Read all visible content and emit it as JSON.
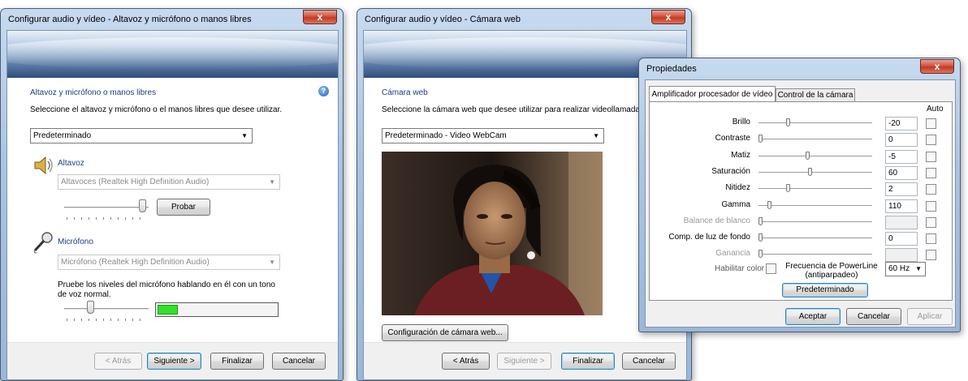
{
  "win1": {
    "title": "Configurar audio y vídeo - Altavoz y micrófono o manos libres",
    "close": "x",
    "help_glyph": "?",
    "heading": "Altavoz y micrófono o manos libres",
    "instruction": "Seleccione el altavoz y micrófono o el manos libres que desee utilizar.",
    "device_select": "Predeterminado",
    "speaker_label": "Altavoz",
    "speaker_select": "Altavoces (Realtek High Definition Audio)",
    "probar": "Probar",
    "mic_label": "Micrófono",
    "mic_select": "Micrófono (Realtek High Definition Audio)",
    "mic_hint": "Pruebe los niveles del micrófono hablando en él con un tono de voz normal.",
    "mic_level_fraction": 0.17,
    "back": "< Atrás",
    "next": "Siguiente >",
    "finish": "Finalizar",
    "cancel": "Cancelar"
  },
  "win2": {
    "title": "Configurar audio y vídeo - Cámara web",
    "close": "x",
    "heading": "Cámara web",
    "instruction": "Seleccione la cámara web que desee utilizar para realizar videollamadas",
    "cam_select": "Predeterminado - Video WebCam",
    "cam_settings": "Configuración de cámara web...",
    "back": "< Atrás",
    "next": "Siguiente >",
    "finish": "Finalizar",
    "cancel": "Cancelar"
  },
  "props": {
    "title": "Propiedades",
    "close": "x",
    "tab1": "Amplificador procesador de vídeo",
    "tab2": "Control de la cámara",
    "auto": "Auto",
    "rows": [
      {
        "label": "Brillo",
        "value": "-20",
        "enabled": true,
        "level": 0.25
      },
      {
        "label": "Contraste",
        "value": "0",
        "enabled": true,
        "level": 0.0
      },
      {
        "label": "Matiz",
        "value": "-5",
        "enabled": true,
        "level": 0.43
      },
      {
        "label": "Saturación",
        "value": "60",
        "enabled": true,
        "level": 0.45
      },
      {
        "label": "Nitidez",
        "value": "2",
        "enabled": true,
        "level": 0.25
      },
      {
        "label": "Gamma",
        "value": "110",
        "enabled": true,
        "level": 0.08
      },
      {
        "label": "Balance de blanco",
        "value": "",
        "enabled": false,
        "level": 0.0
      },
      {
        "label": "Comp. de luz de fondo",
        "value": "0",
        "enabled": true,
        "level": 0.0
      },
      {
        "label": "Ganancia",
        "value": "",
        "enabled": false,
        "level": 0.0
      }
    ],
    "color_enable": "Habilitar color",
    "powerline_label_1": "Frecuencia de PowerLine",
    "powerline_label_2": "(antiparpadeo)",
    "powerline_value": "60 Hz",
    "default_btn": "Predeterminado",
    "accept": "Aceptar",
    "cancel": "Cancelar",
    "apply": "Aplicar"
  },
  "colors": {
    "heading_blue": "#1a3e8a",
    "level_green": "#33e02b",
    "title_close_red": "#c13b22"
  }
}
